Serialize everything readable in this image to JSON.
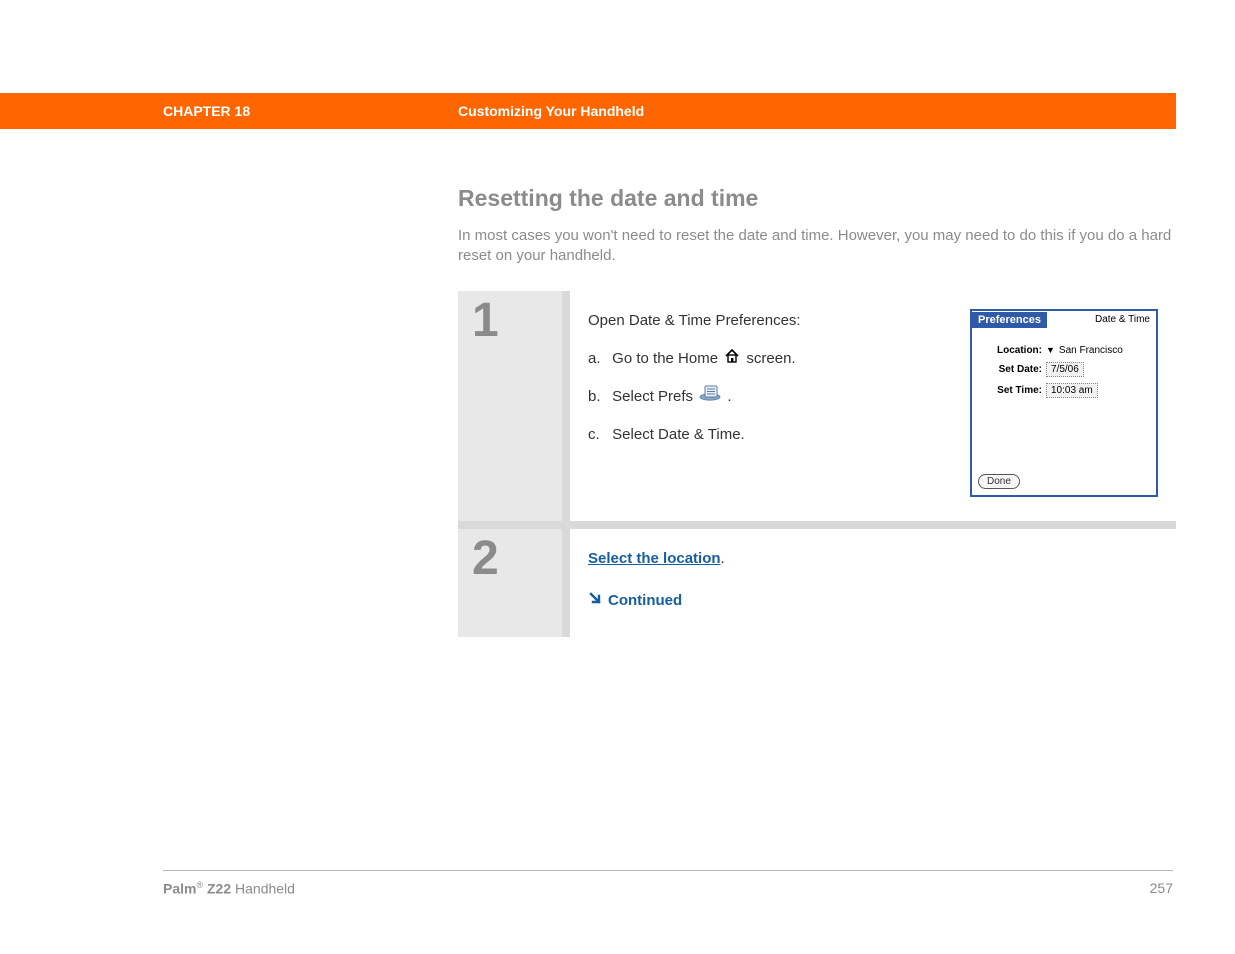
{
  "header": {
    "chapter_label": "CHAPTER 18",
    "chapter_title": "Customizing Your Handheld"
  },
  "section": {
    "heading": "Resetting the date and time",
    "intro": "In most cases you won't need to reset the date and time. However, you may need to do this if you do a hard reset on your handheld."
  },
  "steps": [
    {
      "number": "1",
      "lead": "Open Date & Time Preferences:",
      "subs": {
        "a_letter": "a.",
        "a_pre": "Go to the Home ",
        "a_post": " screen.",
        "b_letter": "b.",
        "b_pre": "Select Prefs ",
        "b_post": ".",
        "c_letter": "c.",
        "c_text": "Select Date & Time."
      },
      "screenshot": {
        "title_left": "Preferences",
        "title_right": "Date & Time",
        "location_label": "Location:",
        "location_value": "San Francisco",
        "date_label": "Set Date:",
        "date_value": "7/5/06",
        "time_label": "Set Time:",
        "time_value": "10:03 am",
        "done_label": "Done"
      }
    },
    {
      "number": "2",
      "link_text": "Select the location",
      "link_suffix": ".",
      "continued_label": "Continued"
    }
  ],
  "footer": {
    "brand_prefix": "Palm",
    "brand_reg": "®",
    "brand_model": " Z22",
    "brand_suffix": " Handheld",
    "page_number": "257"
  }
}
